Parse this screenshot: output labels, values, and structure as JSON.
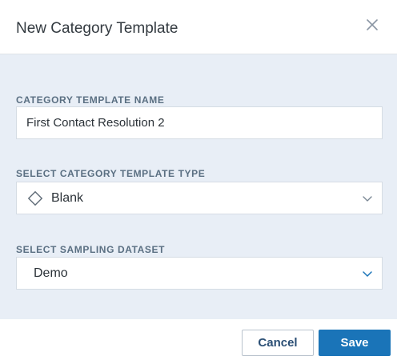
{
  "dialog": {
    "title": "New Category Template",
    "close_icon": "close-icon"
  },
  "form": {
    "name_field": {
      "label": "CATEGORY TEMPLATE NAME",
      "value": "First Contact Resolution 2",
      "placeholder": ""
    },
    "type_field": {
      "label": "SELECT CATEGORY TEMPLATE TYPE",
      "selected": "Blank",
      "icon": "diamond-icon"
    },
    "dataset_field": {
      "label": "SELECT SAMPLING DATASET",
      "selected": "Demo"
    }
  },
  "footer": {
    "cancel_label": "Cancel",
    "save_label": "Save"
  },
  "colors": {
    "body_background": "#e8eef6",
    "primary_button": "#1a74b8",
    "label_text": "#5a6f82",
    "dataset_chevron": "#1a74b8",
    "type_chevron": "#7a8794"
  }
}
